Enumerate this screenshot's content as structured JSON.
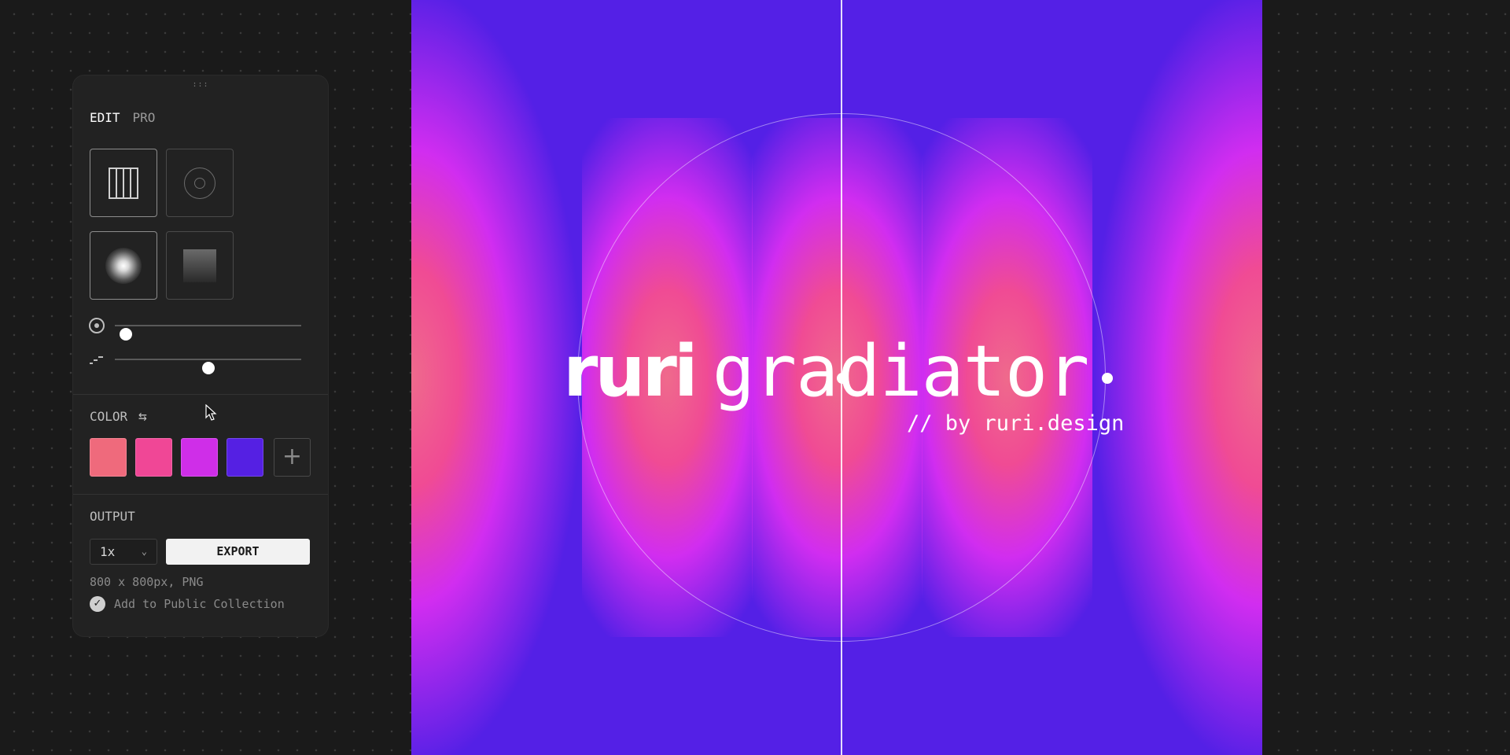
{
  "panel": {
    "drag_handle": ":::",
    "tabs": {
      "edit": "EDIT",
      "pro": "PRO"
    },
    "gradient_types": [
      {
        "icon": "vertical-bars-icon",
        "active": true
      },
      {
        "icon": "concentric-circles-icon",
        "active": false
      },
      {
        "icon": "radial-glow-icon",
        "active": false
      },
      {
        "icon": "linear-gradient-icon",
        "active": false
      }
    ],
    "sliders": [
      {
        "icon": "target-icon",
        "value": 0.06
      },
      {
        "icon": "dash-steps-icon",
        "value": 0.5
      }
    ],
    "color": {
      "label": "COLOR",
      "swap_icon": "⇆",
      "swatches": [
        "#ef6a7c",
        "#f04796",
        "#cf2ee8",
        "#5520e3"
      ],
      "add_label": "+"
    },
    "output": {
      "label": "OUTPUT",
      "scale": "1x",
      "export_label": "EXPORT",
      "info": "800 x 800px, PNG",
      "collection_label": "Add to Public Collection",
      "collection_checked": true
    }
  },
  "canvas": {
    "background": "#5420e6",
    "logo_bold": "ruri",
    "logo_light": "gradiator",
    "tagline": "// by ruri.design"
  }
}
